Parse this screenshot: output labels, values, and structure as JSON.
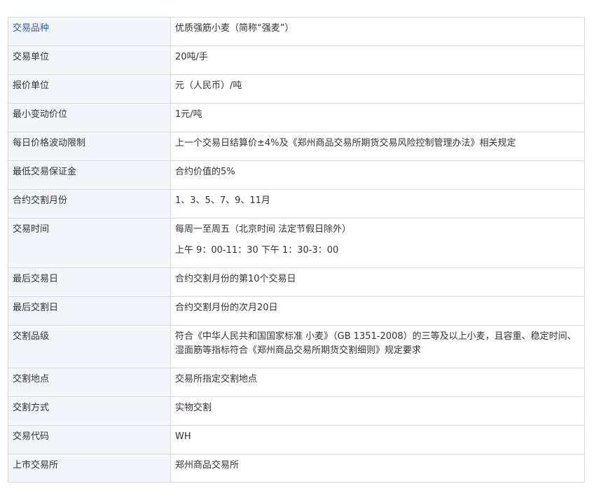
{
  "rows": [
    {
      "label": "交易品种",
      "value": "优质强筋小麦（简称“强麦”）"
    },
    {
      "label": "交易单位",
      "value": "20吨/手"
    },
    {
      "label": "报价单位",
      "value": "元（人民币）/吨"
    },
    {
      "label": "最小变动价位",
      "value": "1元/吨"
    },
    {
      "label": "每日价格波动限制",
      "value": "上一个交易日结算价±4%及《郑州商品交易所期货交易风险控制管理办法》相关规定"
    },
    {
      "label": "最低交易保证金",
      "value": "合约价值的5%"
    },
    {
      "label": "合约交割月份",
      "value": "1、3、5、7、9、11月"
    },
    {
      "label": "交易时间",
      "value": "每周一至周五（北京时间 法定节假日除外）",
      "value2": "上午 9：00-11：30 下午 1：30-3：00"
    },
    {
      "label": "最后交易日",
      "value": "合约交割月份的第10个交易日"
    },
    {
      "label": "最后交割日",
      "value": "合约交割月份的次月20日"
    },
    {
      "label": "交割品级",
      "value": "符合《中华人民共和国国家标准 小麦》（GB 1351-2008）的三等及以上小麦，且容重、稳定时间、湿面筋等指标符合《郑州商品交易所期货交割细则》规定要求"
    },
    {
      "label": "交割地点",
      "value": "交易所指定交割地点"
    },
    {
      "label": "交割方式",
      "value": "实物交割"
    },
    {
      "label": "交易代码",
      "value": "WH"
    },
    {
      "label": "上市交易所",
      "value": "郑州商品交易所"
    }
  ]
}
